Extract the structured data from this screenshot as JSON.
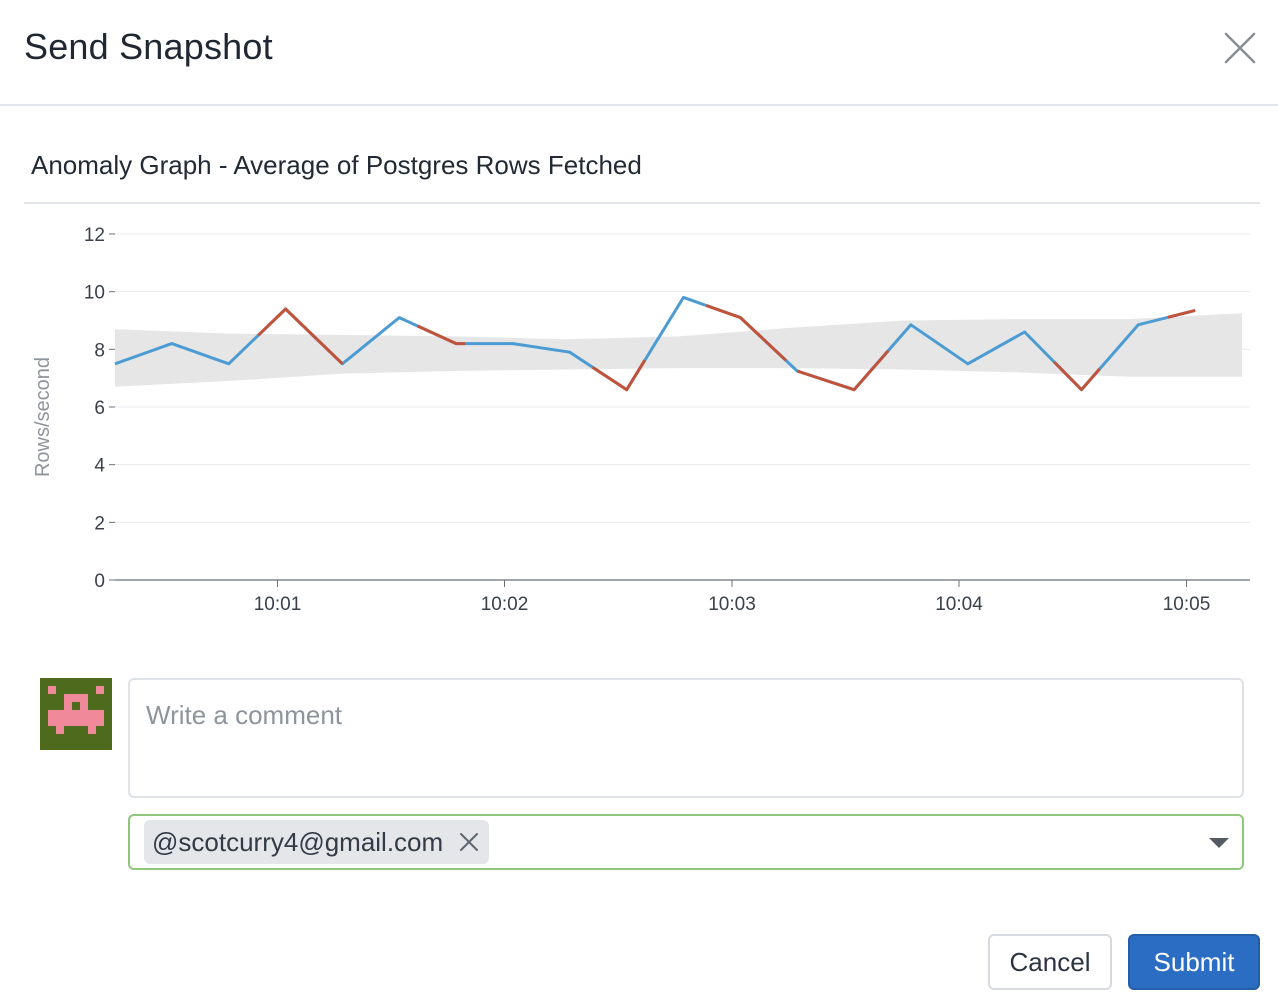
{
  "dialog": {
    "title": "Send Snapshot"
  },
  "graph": {
    "title": "Anomaly Graph - Average of Postgres Rows Fetched"
  },
  "chart_data": {
    "type": "line",
    "ylabel": "Rows/second",
    "ylim": [
      0,
      12
    ],
    "y_ticks": [
      "0",
      "2",
      "4",
      "6",
      "8",
      "10",
      "12"
    ],
    "x_tick_labels": [
      "10:01",
      "10:02",
      "10:03",
      "10:04",
      "10:05"
    ],
    "grid": "horizontal",
    "colors": {
      "normal": "#4c9cd3",
      "anomaly": "#c1533a",
      "band": "#e6e6e6"
    },
    "series": [
      {
        "values": [
          [
            0.0,
            7.5
          ],
          [
            0.25,
            8.2
          ],
          [
            0.5,
            7.5
          ],
          [
            0.75,
            9.4
          ],
          [
            1.0,
            7.5
          ],
          [
            1.25,
            9.1
          ],
          [
            1.5,
            8.2
          ],
          [
            1.75,
            8.2
          ],
          [
            2.0,
            7.9
          ],
          [
            2.25,
            6.6
          ],
          [
            2.5,
            9.8
          ],
          [
            2.75,
            9.1
          ],
          [
            3.0,
            7.25
          ],
          [
            3.25,
            6.6
          ],
          [
            3.5,
            8.85
          ],
          [
            3.75,
            7.5
          ],
          [
            4.0,
            8.6
          ],
          [
            4.25,
            6.6
          ],
          [
            4.5,
            8.85
          ],
          [
            4.75,
            9.35
          ]
        ],
        "anomalous": [
          [
            0.63,
            1.0
          ],
          [
            1.33,
            1.54
          ],
          [
            2.1,
            2.33
          ],
          [
            2.6,
            2.95
          ],
          [
            3.0,
            3.4
          ],
          [
            4.13,
            4.33
          ],
          [
            4.63,
            4.75
          ]
        ]
      }
    ],
    "bounds": {
      "upper": [
        [
          0.0,
          8.7
        ],
        [
          0.5,
          8.55
        ],
        [
          1.0,
          8.5
        ],
        [
          1.5,
          8.45
        ],
        [
          2.0,
          8.35
        ],
        [
          2.5,
          8.45
        ],
        [
          3.0,
          8.75
        ],
        [
          3.5,
          9.0
        ],
        [
          4.0,
          9.05
        ],
        [
          4.5,
          9.05
        ],
        [
          5.0,
          9.25
        ]
      ],
      "lower": [
        [
          0.0,
          6.7
        ],
        [
          0.5,
          6.9
        ],
        [
          1.0,
          7.15
        ],
        [
          1.5,
          7.25
        ],
        [
          2.0,
          7.3
        ],
        [
          2.5,
          7.35
        ],
        [
          3.0,
          7.35
        ],
        [
          3.5,
          7.3
        ],
        [
          4.0,
          7.2
        ],
        [
          4.5,
          7.05
        ],
        [
          5.0,
          7.05
        ]
      ]
    }
  },
  "comment": {
    "placeholder": "Write a comment"
  },
  "recipients": {
    "tags": [
      "@scotcurry4@gmail.com"
    ]
  },
  "actions": {
    "cancel_label": "Cancel",
    "submit_label": "Submit"
  }
}
